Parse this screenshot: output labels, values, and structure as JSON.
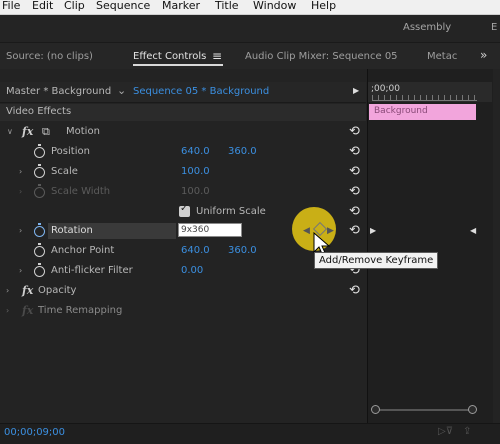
{
  "menu": [
    "File",
    "Edit",
    "Clip",
    "Sequence",
    "Marker",
    "Title",
    "Window",
    "Help"
  ],
  "workspaces": [
    "Assembly",
    "E"
  ],
  "tabs": {
    "source": "Source: (no clips)",
    "effect_controls": "Effect Controls",
    "audio_mixer": "Audio Clip Mixer: Sequence 05",
    "metadata": "Metac",
    "more": "»"
  },
  "master": {
    "master_label": "Master * Background",
    "sequence_label": "Sequence 05 * Background"
  },
  "timeline": {
    "start_time": ";00;00",
    "clip_name": "Background",
    "current_time": "00;00;09;00"
  },
  "effects": {
    "section_title": "Video Effects",
    "motion": {
      "name": "Motion",
      "position": {
        "label": "Position",
        "x": "640.0",
        "y": "360.0"
      },
      "scale": {
        "label": "Scale",
        "value": "100.0"
      },
      "scale_width": {
        "label": "Scale Width",
        "value": "100.0"
      },
      "uniform_scale": {
        "label": "Uniform Scale",
        "checked": true
      },
      "rotation": {
        "label": "Rotation",
        "value": "9x360"
      },
      "anchor_point": {
        "label": "Anchor Point",
        "x": "640.0",
        "y": "360.0"
      },
      "anti_flicker": {
        "label": "Anti-flicker Filter",
        "value": "0.00"
      }
    },
    "opacity": {
      "name": "Opacity"
    },
    "time_remapping": {
      "name": "Time Remapping"
    }
  },
  "tooltip": "Add/Remove Keyframe",
  "colors": {
    "value_blue": "#3b8fe0",
    "clip_pink": "#f2a5dc",
    "highlight_yellow": "#e6c814"
  }
}
